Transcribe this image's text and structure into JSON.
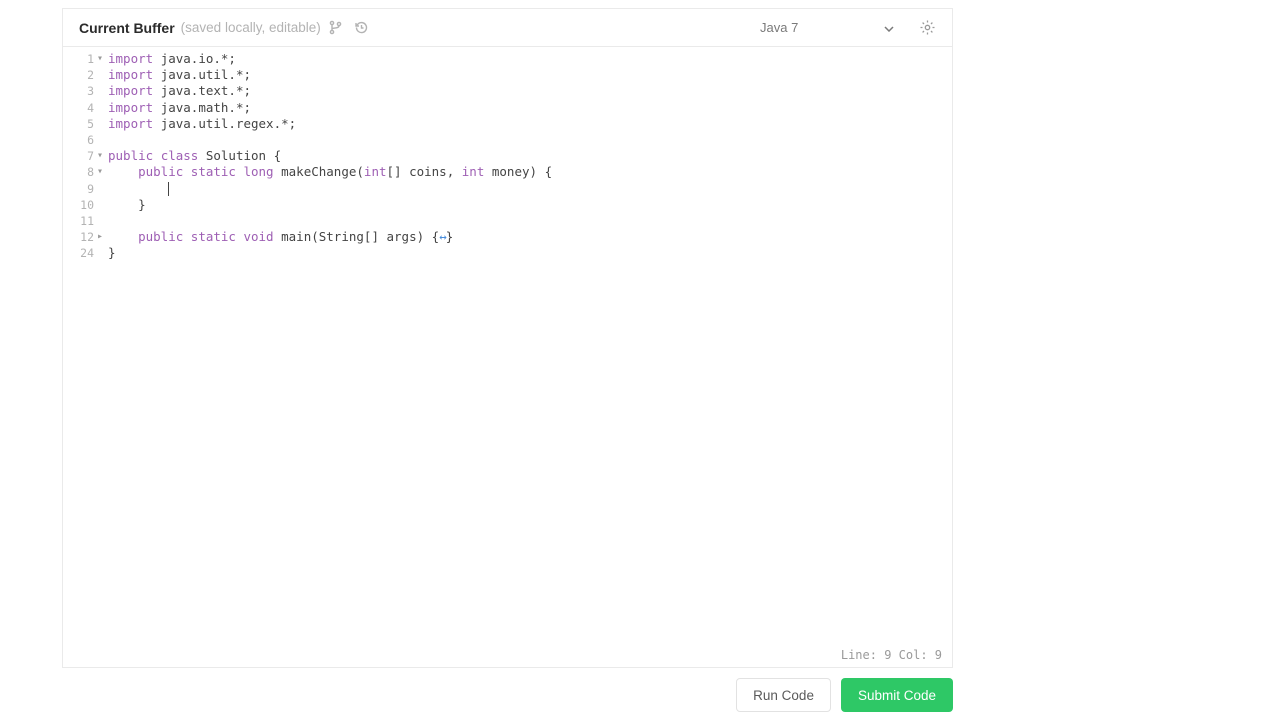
{
  "header": {
    "title": "Current Buffer",
    "subtitle": "(saved locally, editable)",
    "language": "Java 7"
  },
  "code": {
    "lines": [
      {
        "num": "1",
        "fold": "▾",
        "tokens": [
          {
            "t": "import ",
            "c": "tok-kw"
          },
          {
            "t": "java.io.*;",
            "c": "tok-id"
          }
        ]
      },
      {
        "num": "2",
        "fold": "",
        "tokens": [
          {
            "t": "import ",
            "c": "tok-kw"
          },
          {
            "t": "java.util.*;",
            "c": "tok-id"
          }
        ]
      },
      {
        "num": "3",
        "fold": "",
        "tokens": [
          {
            "t": "import ",
            "c": "tok-kw"
          },
          {
            "t": "java.text.*;",
            "c": "tok-id"
          }
        ]
      },
      {
        "num": "4",
        "fold": "",
        "tokens": [
          {
            "t": "import ",
            "c": "tok-kw"
          },
          {
            "t": "java.math.*;",
            "c": "tok-id"
          }
        ]
      },
      {
        "num": "5",
        "fold": "",
        "tokens": [
          {
            "t": "import ",
            "c": "tok-kw"
          },
          {
            "t": "java.util.regex.*;",
            "c": "tok-id"
          }
        ]
      },
      {
        "num": "6",
        "fold": "",
        "tokens": []
      },
      {
        "num": "7",
        "fold": "▾",
        "tokens": [
          {
            "t": "public ",
            "c": "tok-kw"
          },
          {
            "t": "class ",
            "c": "tok-kw"
          },
          {
            "t": "Solution ",
            "c": "tok-id"
          },
          {
            "t": "{",
            "c": "tok-punct"
          }
        ]
      },
      {
        "num": "8",
        "fold": "▾",
        "tokens": [
          {
            "t": "    ",
            "c": ""
          },
          {
            "t": "public ",
            "c": "tok-kw"
          },
          {
            "t": "static ",
            "c": "tok-kw"
          },
          {
            "t": "long ",
            "c": "tok-type"
          },
          {
            "t": "makeChange",
            "c": "tok-fn"
          },
          {
            "t": "(",
            "c": "tok-punct"
          },
          {
            "t": "int",
            "c": "tok-type"
          },
          {
            "t": "[] coins, ",
            "c": "tok-id"
          },
          {
            "t": "int ",
            "c": "tok-type"
          },
          {
            "t": "money",
            "c": "tok-id"
          },
          {
            "t": ") {",
            "c": "tok-punct"
          }
        ]
      },
      {
        "num": "9",
        "fold": "",
        "tokens": [
          {
            "t": "        ",
            "c": ""
          }
        ],
        "caret": true
      },
      {
        "num": "10",
        "fold": "",
        "tokens": [
          {
            "t": "    }",
            "c": "tok-punct"
          }
        ]
      },
      {
        "num": "11",
        "fold": "",
        "tokens": []
      },
      {
        "num": "12",
        "fold": "▸",
        "tokens": [
          {
            "t": "    ",
            "c": ""
          },
          {
            "t": "public ",
            "c": "tok-kw"
          },
          {
            "t": "static ",
            "c": "tok-kw"
          },
          {
            "t": "void ",
            "c": "tok-type"
          },
          {
            "t": "main",
            "c": "tok-fn"
          },
          {
            "t": "(String[] args) ",
            "c": "tok-id"
          },
          {
            "t": "{",
            "c": "tok-punct"
          },
          {
            "t": "↔",
            "c": "tok-fold"
          },
          {
            "t": "}",
            "c": "tok-punct"
          }
        ]
      },
      {
        "num": "24",
        "fold": "",
        "tokens": [
          {
            "t": "}",
            "c": "tok-punct"
          }
        ]
      }
    ]
  },
  "status": {
    "text": "Line: 9 Col: 9"
  },
  "actions": {
    "run": "Run Code",
    "submit": "Submit Code"
  }
}
